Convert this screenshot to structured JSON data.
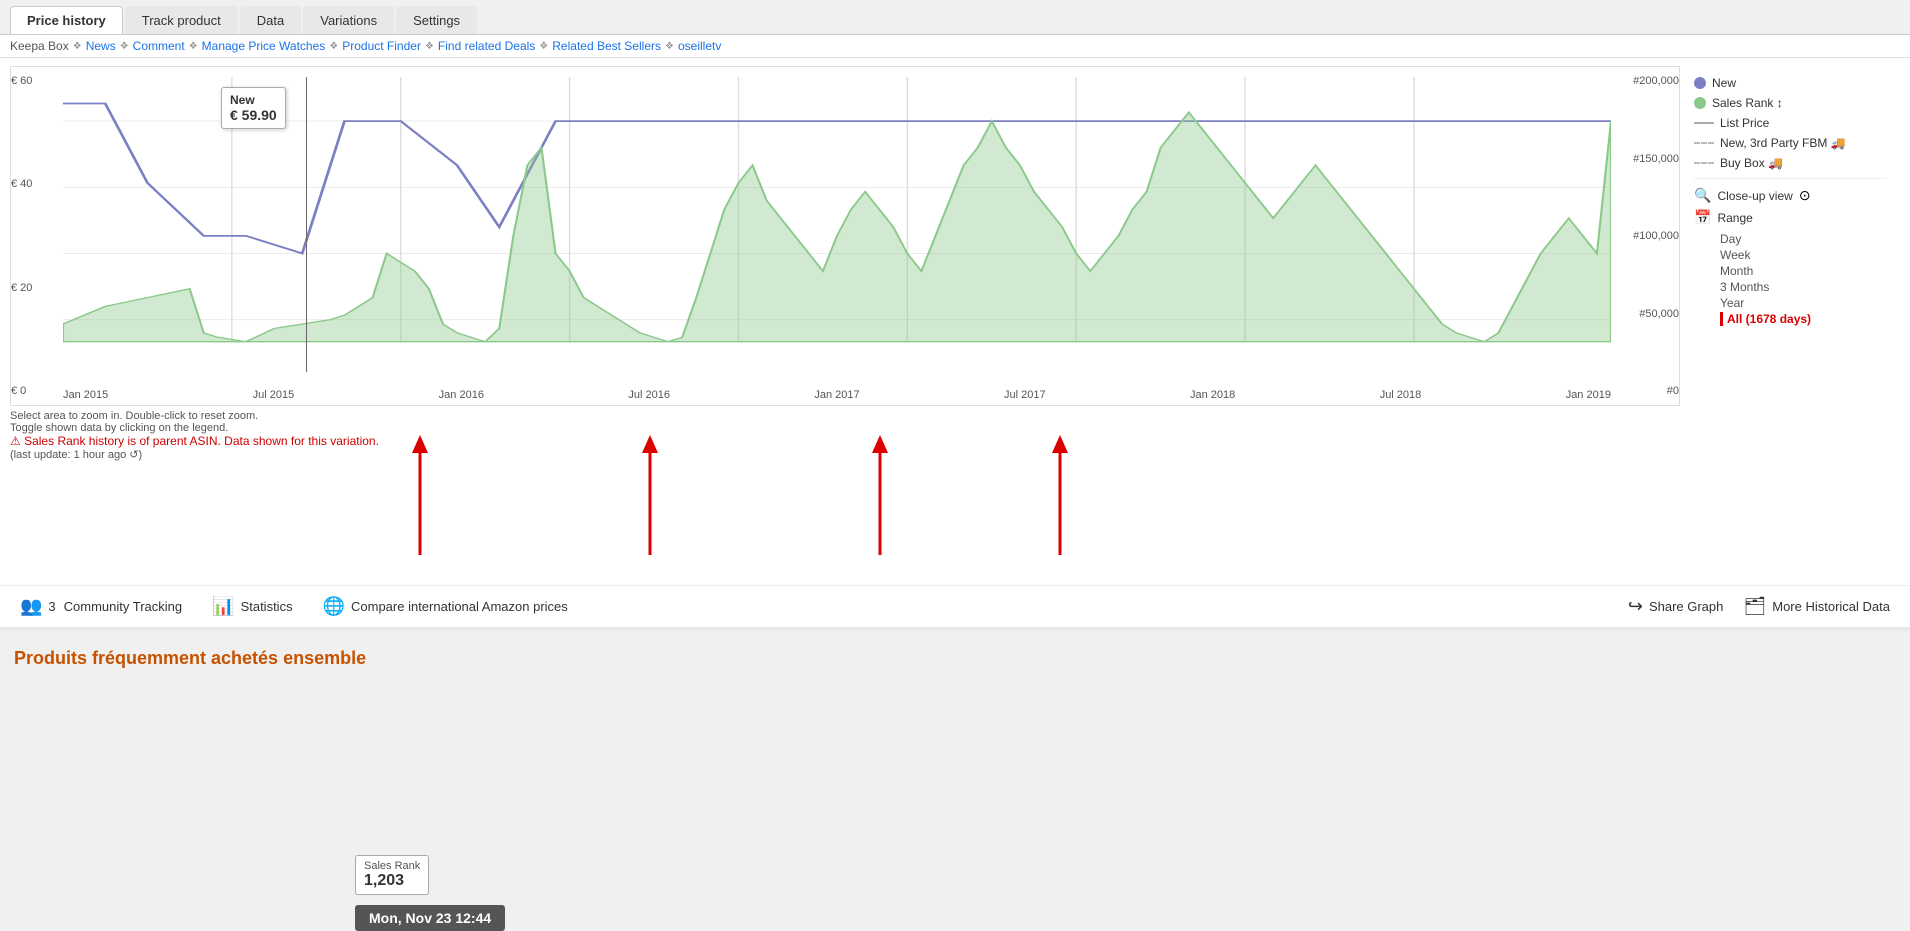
{
  "tabs": [
    {
      "id": "price-history",
      "label": "Price history",
      "active": true
    },
    {
      "id": "track-product",
      "label": "Track product",
      "active": false
    },
    {
      "id": "data",
      "label": "Data",
      "active": false
    },
    {
      "id": "variations",
      "label": "Variations",
      "active": false
    },
    {
      "id": "settings",
      "label": "Settings",
      "active": false
    }
  ],
  "nav_links": [
    {
      "label": "Keepa Box",
      "type": "text"
    },
    {
      "label": "News",
      "type": "link"
    },
    {
      "label": "Comment",
      "type": "link"
    },
    {
      "label": "Manage Price Watches",
      "type": "link"
    },
    {
      "label": "Product Finder",
      "type": "link"
    },
    {
      "label": "Find related Deals",
      "type": "link"
    },
    {
      "label": "Related Best Sellers",
      "type": "link"
    },
    {
      "label": "oseilletv",
      "type": "link"
    }
  ],
  "chart": {
    "tooltip_label": "New",
    "tooltip_price": "€ 59.90",
    "sales_rank_label": "Sales Rank",
    "sales_rank_value": "1,203",
    "tooltip_date": "Mon, Nov 23 12:44",
    "y_axis_left": [
      "€ 60",
      "€ 40",
      "€ 20",
      "€ 0"
    ],
    "y_axis_right": [
      "#200,000",
      "#150,000",
      "#100,000",
      "#50,000",
      "#0"
    ],
    "x_axis": [
      "Jan 2015",
      "Jul 2015",
      "Jan 2016",
      "Jul 2016",
      "Jan 2017",
      "Jul 2017",
      "Jan 2018",
      "Jul 2018",
      "Jan 2019"
    ]
  },
  "legend": {
    "items": [
      {
        "type": "dot",
        "color": "#7b7fc4",
        "label": "New"
      },
      {
        "type": "dot",
        "color": "#8bc98b",
        "label": "Sales Rank ↕"
      },
      {
        "type": "dash",
        "color": "#aaa",
        "style": "solid",
        "label": "List Price"
      },
      {
        "type": "dash",
        "color": "#bbb",
        "style": "dashed",
        "label": "New, 3rd Party FBM 🚚"
      },
      {
        "type": "dash",
        "color": "#bbb",
        "style": "dashed",
        "label": "Buy Box 🚚"
      }
    ],
    "closeup_label": "Close-up view",
    "range_label": "Range",
    "range_options": [
      {
        "label": "Day",
        "active": false
      },
      {
        "label": "Week",
        "active": false
      },
      {
        "label": "Month",
        "active": false
      },
      {
        "label": "3 Months",
        "active": false
      },
      {
        "label": "Year",
        "active": false
      },
      {
        "label": "All (1678 days)",
        "active": true
      }
    ]
  },
  "chart_info": {
    "line1": "Select area to zoom in. Double-click to reset zoom.",
    "line2": "Toggle shown data by clicking on the legend.",
    "warning": "⚠ Sales Rank history is of parent ASIN. Data shown for this variation.",
    "update": "(last update: 1 hour ago ↺)"
  },
  "bottom_bar": {
    "community_count": "3",
    "community_label": "Community Tracking",
    "statistics_label": "Statistics",
    "compare_label": "Compare international Amazon prices",
    "share_label": "Share Graph",
    "more_label": "More Historical Data"
  },
  "section_title": "Produits fréquemment achetés ensemble"
}
